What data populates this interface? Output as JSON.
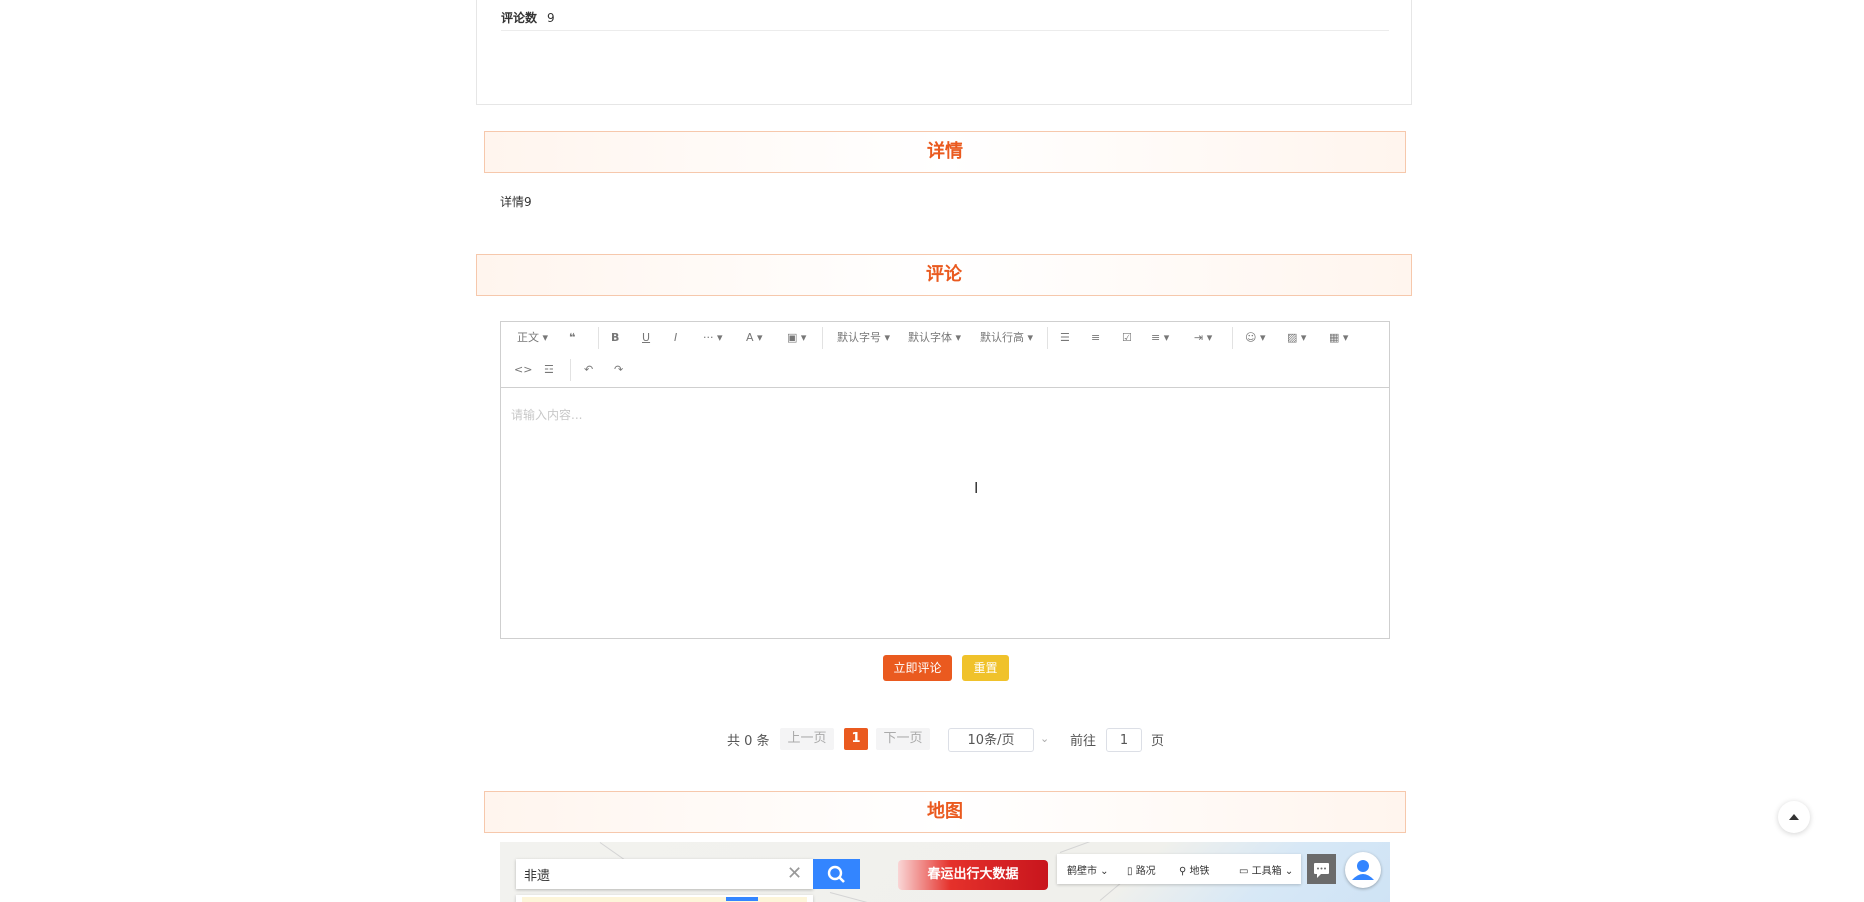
{
  "info": {
    "comments_label": "评论数",
    "comments_value": "9"
  },
  "sections": {
    "detail_title": "详情",
    "comment_title": "评论",
    "map_title": "地图"
  },
  "detail": {
    "text": "详情9"
  },
  "editor": {
    "toolbar": {
      "paragraph": "正文",
      "font_size": "默认字号",
      "font_family": "默认字体",
      "line_height": "默认行高"
    },
    "placeholder": "请输入内容..."
  },
  "actions": {
    "submit_label": "立即评论",
    "reset_label": "重置",
    "submit_color": "#ea5a1f",
    "reset_color": "#f0c22b"
  },
  "pagination": {
    "total_text": "共 0 条",
    "prev_label": "上一页",
    "current_page": "1",
    "next_label": "下一页",
    "page_size": "10条/页",
    "goto_label": "前往",
    "goto_value": "1",
    "page_suffix": "页"
  },
  "map": {
    "search_value": "非遗",
    "banner_text": "春运出行大数据",
    "tools": {
      "city": "鹤壁市",
      "traffic": "路况",
      "subway": "地铁",
      "toolbox": "工具箱"
    }
  },
  "colors": {
    "accent": "#ea5a1f",
    "map_blue": "#3385ff"
  }
}
